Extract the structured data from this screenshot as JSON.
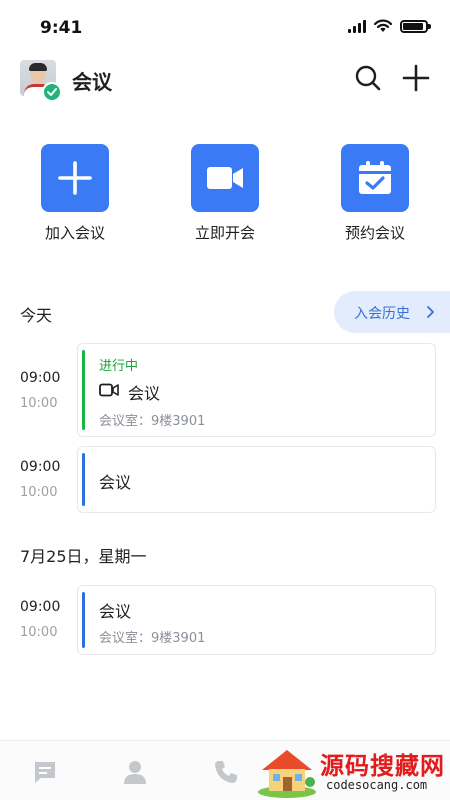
{
  "status_bar": {
    "time": "9:41"
  },
  "header": {
    "title": "会议"
  },
  "actions": [
    {
      "label": "加入会议",
      "icon": "plus-icon"
    },
    {
      "label": "立即开会",
      "icon": "video-camera-icon"
    },
    {
      "label": "预约会议",
      "icon": "calendar-check-icon"
    }
  ],
  "sections": {
    "today": "今天",
    "history_button": "入会历史",
    "date": "7月25日，星期一"
  },
  "meetings": [
    {
      "start": "09:00",
      "end": "10:00",
      "status": "进行中",
      "title": "会议",
      "room": "会议室：9楼3901",
      "bar_color": "#19b33f"
    },
    {
      "start": "09:00",
      "end": "10:00",
      "title": "会议",
      "bar_color": "#2f6fe0"
    },
    {
      "start": "09:00",
      "end": "10:00",
      "title": "会议",
      "room": "会议室：9楼3901",
      "bar_color": "#2f6fe0"
    }
  ],
  "watermark": {
    "title": "源码搜藏网",
    "url": "codesocang.com"
  },
  "colors": {
    "accent": "#3a7af5",
    "live": "#19a33a",
    "badge": "#1fb479"
  }
}
